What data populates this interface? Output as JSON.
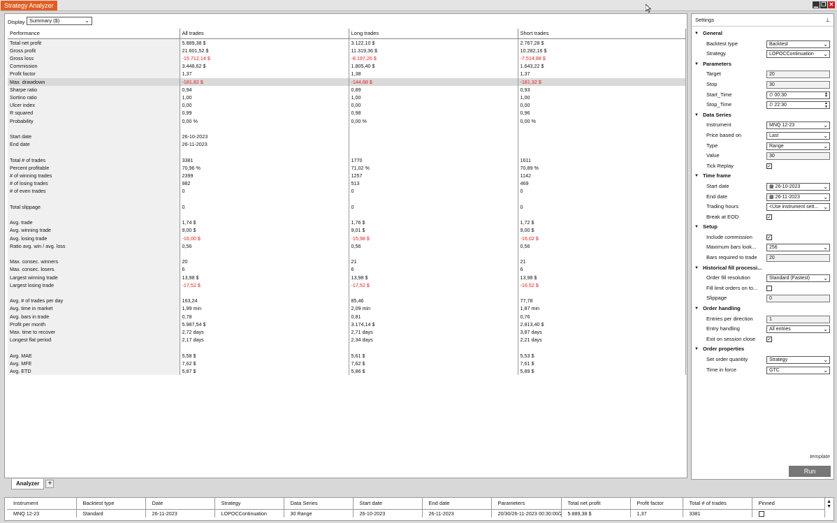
{
  "app": {
    "title": "Strategy Analyzer",
    "minimize": "▁",
    "restore": "❐",
    "close": "✕"
  },
  "display": {
    "label": "Display",
    "value": "Summary ($)"
  },
  "performance": {
    "headers": [
      "Performance",
      "All trades",
      "Long trades",
      "Short trades"
    ],
    "rows": [
      {
        "label": "Total net profit",
        "all": "5.889,38 $",
        "long": "3.122,10 $",
        "short": "2.767,28 $"
      },
      {
        "label": "Gross profit",
        "all": "21.601,52 $",
        "long": "11.319,36 $",
        "short": "10.282,16 $"
      },
      {
        "label": "Gross loss",
        "all": "-15.712,14 $",
        "long": "-8.197,26 $",
        "short": "-7.514,88 $",
        "neg": true
      },
      {
        "label": "Commission",
        "all": "3.448,62 $",
        "long": "1.805,40 $",
        "short": "1.643,22 $"
      },
      {
        "label": "Profit factor",
        "all": "1,37",
        "long": "1,38",
        "short": "1,37"
      },
      {
        "label": "Max. drawdown",
        "all": "-181,82 $",
        "long": "-144,68 $",
        "short": "-181,32 $",
        "neg": true,
        "highlight": true
      },
      {
        "label": "Sharpe ratio",
        "all": "0,94",
        "long": "0,89",
        "short": "0,93"
      },
      {
        "label": "Sortino ratio",
        "all": "1,00",
        "long": "1,00",
        "short": "1,00"
      },
      {
        "label": "Ulcer index",
        "all": "0,00",
        "long": "0,00",
        "short": "0,00"
      },
      {
        "label": "R squared",
        "all": "0,99",
        "long": "0,98",
        "short": "0,96"
      },
      {
        "label": "Probability",
        "all": "0,00 %",
        "long": "0,00 %",
        "short": "0,00 %"
      },
      {
        "label": "",
        "all": "",
        "long": "",
        "short": "",
        "blank": true
      },
      {
        "label": "Start date",
        "all": "26-10-2023",
        "long": "",
        "short": ""
      },
      {
        "label": "End date",
        "all": "26-11-2023",
        "long": "",
        "short": ""
      },
      {
        "label": "",
        "all": "",
        "long": "",
        "short": "",
        "blank": true
      },
      {
        "label": "Total # of trades",
        "all": "3381",
        "long": "1770",
        "short": "1611"
      },
      {
        "label": "Percent profitable",
        "all": "70,96 %",
        "long": "71,02 %",
        "short": "70,89 %"
      },
      {
        "label": "# of winning trades",
        "all": "2399",
        "long": "1257",
        "short": "1142"
      },
      {
        "label": "# of losing trades",
        "all": "982",
        "long": "513",
        "short": "469"
      },
      {
        "label": "# of even trades",
        "all": "0",
        "long": "0",
        "short": "0"
      },
      {
        "label": "",
        "all": "",
        "long": "",
        "short": "",
        "blank": true
      },
      {
        "label": "Total slippage",
        "all": "0",
        "long": "0",
        "short": "0"
      },
      {
        "label": "",
        "all": "",
        "long": "",
        "short": "",
        "blank": true
      },
      {
        "label": "Avg. trade",
        "all": "1,74 $",
        "long": "1,76 $",
        "short": "1,72 $"
      },
      {
        "label": "Avg. winning trade",
        "all": "9,00 $",
        "long": "9,01 $",
        "short": "9,00 $"
      },
      {
        "label": "Avg. losing trade",
        "all": "-16,00 $",
        "long": "-15,98 $",
        "short": "-16,02 $",
        "neg": true
      },
      {
        "label": "Ratio avg. win / avg. loss",
        "all": "0,56",
        "long": "0,56",
        "short": "0,56"
      },
      {
        "label": "",
        "all": "",
        "long": "",
        "short": "",
        "blank": true
      },
      {
        "label": "Max. consec. winners",
        "all": "20",
        "long": "21",
        "short": "21"
      },
      {
        "label": "Max. consec. losers",
        "all": "6",
        "long": "6",
        "short": "6"
      },
      {
        "label": "Largest winning trade",
        "all": "13,98 $",
        "long": "13,98 $",
        "short": "13,98 $"
      },
      {
        "label": "Largest losing trade",
        "all": "-17,52 $",
        "long": "-17,52 $",
        "short": "-16,52 $",
        "neg": true
      },
      {
        "label": "",
        "all": "",
        "long": "",
        "short": "",
        "blank": true
      },
      {
        "label": "Avg. # of trades per day",
        "all": "163,24",
        "long": "85,46",
        "short": "77,78"
      },
      {
        "label": "Avg. time in market",
        "all": "1,99 min",
        "long": "2,09 min",
        "short": "1,87 min"
      },
      {
        "label": "Avg. bars in trade",
        "all": "0,78",
        "long": "0,81",
        "short": "0,76"
      },
      {
        "label": "Profit per month",
        "all": "5.987,54 $",
        "long": "3.174,14 $",
        "short": "2.813,40 $"
      },
      {
        "label": "Max. time to recover",
        "all": "2,72 days",
        "long": "2,71 days",
        "short": "3,87 days"
      },
      {
        "label": "Longest flat period",
        "all": "2,17 days",
        "long": "2,34 days",
        "short": "2,21 days"
      },
      {
        "label": "",
        "all": "",
        "long": "",
        "short": "",
        "blank": true
      },
      {
        "label": "Avg. MAE",
        "all": "5,58 $",
        "long": "5,61 $",
        "short": "5,53 $"
      },
      {
        "label": "Avg. MFE",
        "all": "7,62 $",
        "long": "7,62 $",
        "short": "7,61 $"
      },
      {
        "label": "Avg. ETD",
        "all": "5,87 $",
        "long": "5,86 $",
        "short": "5,89 $"
      }
    ]
  },
  "settings": {
    "title": "Settings",
    "pin": "⊥",
    "template": "template",
    "run": "Run",
    "sections": [
      {
        "name": "General",
        "rows": [
          {
            "label": "Backtest type",
            "value": "Backtest",
            "kind": "dropdown"
          },
          {
            "label": "Strategy",
            "value": "LOPOCContinuation",
            "kind": "dropdown"
          }
        ]
      },
      {
        "name": "Parameters",
        "rows": [
          {
            "label": "Target",
            "value": "20",
            "kind": "input"
          },
          {
            "label": "Stop",
            "value": "30",
            "kind": "input"
          },
          {
            "label": "Start_Time",
            "value": "⏲ 00:30",
            "kind": "spin"
          },
          {
            "label": "Stop_Time",
            "value": "⏲ 22:30",
            "kind": "spin"
          }
        ]
      },
      {
        "name": "Data Series",
        "rows": [
          {
            "label": "Instrument",
            "value": "MNQ 12-23",
            "kind": "dropdown"
          },
          {
            "label": "Price based on",
            "value": "Last",
            "kind": "dropdown"
          },
          {
            "label": "Type",
            "value": "Range",
            "kind": "dropdown"
          },
          {
            "label": "Value",
            "value": "30",
            "kind": "input"
          },
          {
            "label": "Tick Replay",
            "value": "✓",
            "kind": "check"
          }
        ]
      },
      {
        "name": "Time frame",
        "rows": [
          {
            "label": "Start date",
            "value": "▦ 26-10-2023",
            "kind": "dropdown"
          },
          {
            "label": "End date",
            "value": "▦ 26-11-2023",
            "kind": "dropdown"
          },
          {
            "label": "Trading hours",
            "value": "<Use instrument sett...",
            "kind": "dropdown"
          },
          {
            "label": "Break at EOD",
            "value": "✓",
            "kind": "check"
          }
        ]
      },
      {
        "name": "Setup",
        "rows": [
          {
            "label": "Include commission",
            "value": "✓",
            "kind": "check"
          },
          {
            "label": "Maximum bars look...",
            "value": "256",
            "kind": "dropdown"
          },
          {
            "label": "Bars required to trade",
            "value": "20",
            "kind": "input"
          }
        ]
      },
      {
        "name": "Historical fill processi...",
        "rows": [
          {
            "label": "Order fill resolution",
            "value": "Standard (Fastest)",
            "kind": "dropdown"
          },
          {
            "label": "Fill limit orders on to...",
            "value": "",
            "kind": "check"
          },
          {
            "label": "Slippage",
            "value": "0",
            "kind": "input"
          }
        ]
      },
      {
        "name": "Order handling",
        "rows": [
          {
            "label": "Entries per direction",
            "value": "1",
            "kind": "input"
          },
          {
            "label": "Entry handling",
            "value": "All entries",
            "kind": "dropdown"
          },
          {
            "label": "Exit on session close",
            "value": "✓",
            "kind": "check"
          }
        ]
      },
      {
        "name": "Order properties",
        "rows": [
          {
            "label": "Set order quantity",
            "value": "Strategy",
            "kind": "dropdown"
          },
          {
            "label": "Time in force",
            "value": "GTC",
            "kind": "dropdown"
          }
        ]
      }
    ]
  },
  "tabs": {
    "analyzer": "Analyzer",
    "add": "+"
  },
  "results": {
    "headers": [
      "Instrument",
      "Backtest type",
      "Date",
      "Strategy",
      "Data Series",
      "Start date",
      "End date",
      "Parameters",
      "Total net profit",
      "Profit factor",
      "Total # of trades",
      "Pinned"
    ],
    "rows": [
      [
        "MNQ 12-23",
        "Standard",
        "26-11-2023",
        "LOPOCContinuation",
        "30 Range",
        "26-10-2023",
        "26-11-2023",
        "20/30/26-11-2023 00:30:00/2",
        "5.889,38 $",
        "1,37",
        "3381",
        ""
      ]
    ]
  }
}
